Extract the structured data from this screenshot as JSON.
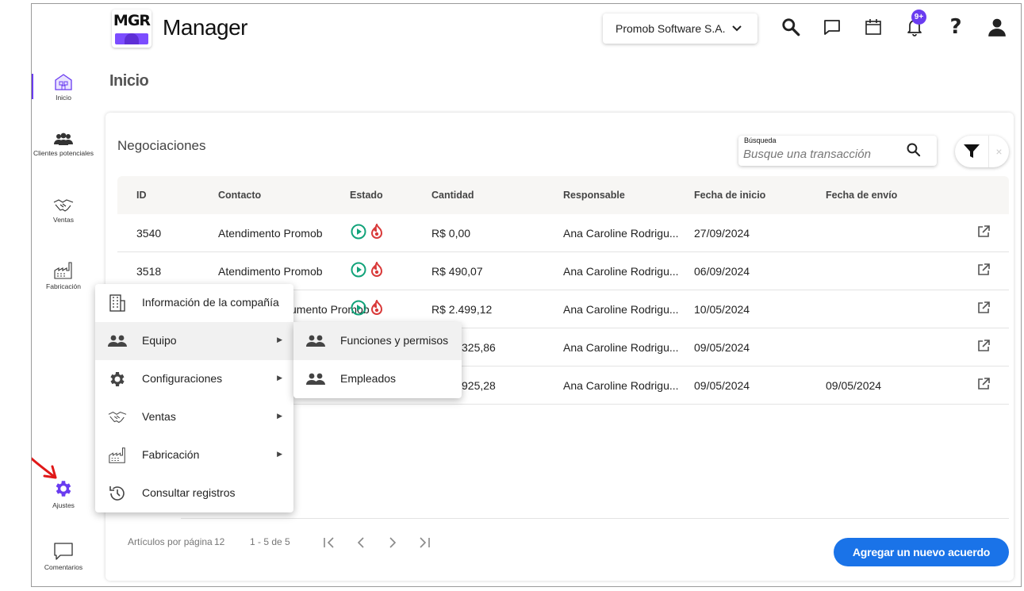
{
  "header": {
    "logo_text": "MGR",
    "app_name": "Manager",
    "company": "Promob Software S.A.",
    "notification_badge": "9+"
  },
  "sidebar": {
    "items": [
      {
        "label": "Inicio",
        "icon": "home-icon"
      },
      {
        "label": "Clientes potenciales",
        "icon": "people-icon"
      },
      {
        "label": "Ventas",
        "icon": "handshake-icon"
      },
      {
        "label": "Fabricación",
        "icon": "factory-icon"
      },
      {
        "label": "Ajustes",
        "icon": "gear-icon"
      },
      {
        "label": "Comentarios",
        "icon": "comment-icon"
      }
    ]
  },
  "page": {
    "title": "Inicio"
  },
  "deals": {
    "title": "Negociaciones",
    "search_label": "Búsqueda",
    "search_placeholder": "Busque una transacción",
    "columns": [
      "ID",
      "Contacto",
      "Estado",
      "Cantidad",
      "Responsable",
      "Fecha de inicio",
      "Fecha de envío"
    ],
    "rows": [
      {
        "id": "3540",
        "contact": "Atendimento Promob",
        "amount": "R$ 0,00",
        "owner": "Ana Caroline Rodrigu...",
        "start": "27/09/2024",
        "sent": ""
      },
      {
        "id": "3518",
        "contact": "Atendimento Promob",
        "amount": "R$ 490,07",
        "owner": "Ana Caroline Rodrigu...",
        "start": "06/09/2024",
        "sent": ""
      },
      {
        "id": "",
        "contact": "Atendimento Promob",
        "amount": "R$ 2.499,12",
        "owner": "Ana Caroline Rodrigu...",
        "start": "10/05/2024",
        "sent": ""
      },
      {
        "id": "",
        "contact": "",
        "amount": "R$ 2.825,86",
        "owner": "Ana Caroline Rodrigu...",
        "start": "09/05/2024",
        "sent": ""
      },
      {
        "id": "",
        "contact": "",
        "amount": "R$ 4.925,28",
        "owner": "Ana Caroline Rodrigu...",
        "start": "09/05/2024",
        "sent": "09/05/2024"
      }
    ],
    "visible_contact_3": "umento Promob",
    "visible_amount_4": "325,86",
    "visible_amount_5": "925,28"
  },
  "footer": {
    "per_page_label": "Artículos por página",
    "per_page": "12",
    "range": "1 - 5 de 5",
    "add_button": "Agregar un nuevo acuerdo"
  },
  "settings_menu": {
    "items": [
      {
        "label": "Información de la compañía",
        "icon": "building-icon",
        "submenu": false
      },
      {
        "label": "Equipo",
        "icon": "team-icon",
        "submenu": true
      },
      {
        "label": "Configuraciones",
        "icon": "gear-icon",
        "submenu": true
      },
      {
        "label": "Ventas",
        "icon": "handshake-icon",
        "submenu": true
      },
      {
        "label": "Fabricación",
        "icon": "factory-icon",
        "submenu": true
      },
      {
        "label": "Consultar registros",
        "icon": "history-icon",
        "submenu": false
      }
    ]
  },
  "team_submenu": {
    "items": [
      {
        "label": "Funciones y permisos",
        "icon": "team-icon"
      },
      {
        "label": "Empleados",
        "icon": "team-icon"
      }
    ]
  },
  "colors": {
    "accent": "#6a3cf0",
    "primary_button": "#1a73e8",
    "play_green": "#12a37a",
    "fire_red": "#d93a3a"
  }
}
